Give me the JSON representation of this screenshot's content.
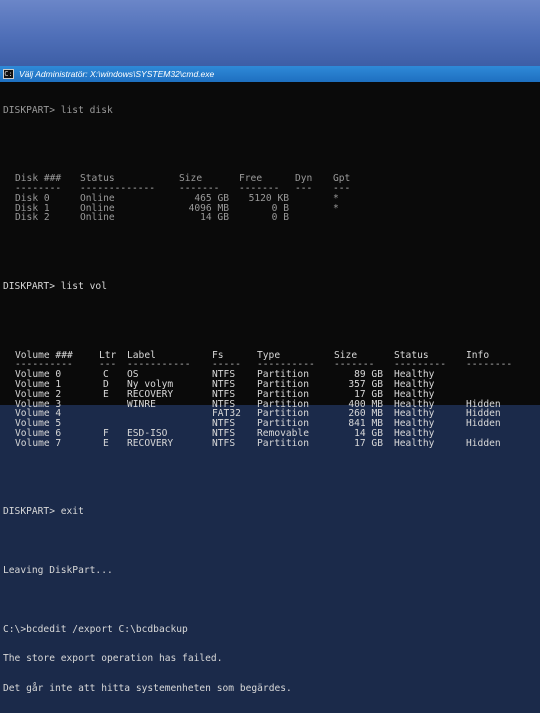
{
  "window": {
    "title": "Välj Administratör: X:\\windows\\SYSTEM32\\cmd.exe",
    "icon": "cmd-icon"
  },
  "disk_command": "DISKPART> list disk",
  "disk_table": {
    "headers": [
      "Disk ###",
      "Status",
      "Size",
      "Free",
      "Dyn",
      "Gpt"
    ],
    "dashes": [
      "--------",
      "-------------",
      "-------",
      "-------",
      "---",
      "---"
    ],
    "rows": [
      [
        "Disk 0",
        "Online",
        "465 GB",
        "5120 KB",
        "",
        "*"
      ],
      [
        "Disk 1",
        "Online",
        "4096 MB",
        "0 B",
        "",
        "*"
      ],
      [
        "Disk 2",
        "Online",
        "14 GB",
        "0 B",
        "",
        ""
      ]
    ]
  },
  "vol_command": "DISKPART> list vol",
  "vol_table": {
    "headers": [
      "Volume ###",
      "Ltr",
      "Label",
      "Fs",
      "Type",
      "Size",
      "Status",
      "Info"
    ],
    "dashes": [
      "----------",
      "---",
      "-----------",
      "-----",
      "----------",
      "-------",
      "---------",
      "--------"
    ],
    "rows": [
      [
        "Volume 0",
        "C",
        "OS",
        "NTFS",
        "Partition",
        "89 GB",
        "Healthy",
        ""
      ],
      [
        "Volume 1",
        "D",
        "Ny volym",
        "NTFS",
        "Partition",
        "357 GB",
        "Healthy",
        ""
      ],
      [
        "Volume 2",
        "E",
        "RECOVERY",
        "NTFS",
        "Partition",
        "17 GB",
        "Healthy",
        ""
      ],
      [
        "Volume 3",
        "",
        "WINRE",
        "NTFS",
        "Partition",
        "400 MB",
        "Healthy",
        "Hidden"
      ],
      [
        "Volume 4",
        "",
        "",
        "FAT32",
        "Partition",
        "260 MB",
        "Healthy",
        "Hidden"
      ],
      [
        "Volume 5",
        "",
        "",
        "NTFS",
        "Partition",
        "841 MB",
        "Healthy",
        "Hidden"
      ],
      [
        "Volume 6",
        "F",
        "ESD-ISO",
        "NTFS",
        "Removable",
        "14 GB",
        "Healthy",
        ""
      ],
      [
        "Volume 7",
        "E",
        "RECOVERY",
        "NTFS",
        "Partition",
        "17 GB",
        "Healthy",
        "Hidden"
      ]
    ]
  },
  "exit_command": "DISKPART> exit",
  "leaving": "Leaving DiskPart...",
  "bcd_command": "C:\\>bcdedit /export C:\\bcdbackup",
  "error_en": "The store export operation has failed.",
  "error_sv": "Det går inte att hitta systemenheten som begärdes."
}
